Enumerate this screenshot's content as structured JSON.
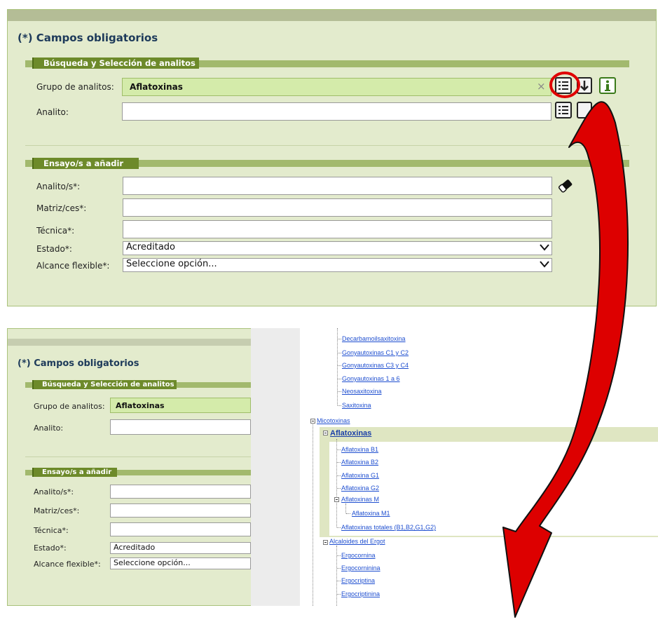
{
  "top_form": {
    "required_note": "(*) Campos obligatorios",
    "search_section": {
      "title": "Búsqueda y Selección de analitos",
      "group_label": "Grupo de analitos:",
      "group_value": "Aflatoxinas",
      "clear_symbol": "×",
      "analyte_label": "Analito:",
      "analyte_value": ""
    },
    "add_section": {
      "title": "Ensayo/s a añadir",
      "analytes_label": "Analito/s*:",
      "matrix_label": "Matriz/ces*:",
      "technique_label": "Técnica*:",
      "state_label": "Estado*:",
      "state_value": "Acreditado",
      "scope_label": "Alcance flexible*:",
      "scope_value": "Seleccione opción..."
    }
  },
  "bottom_form": {
    "required_note": "(*) Campos obligatorios",
    "search_title": "Búsqueda y Selección de analitos",
    "group_label": "Grupo de analitos:",
    "group_value": "Aflatoxinas",
    "analyte_label": "Analito:",
    "add_title": "Ensayo/s a añadir",
    "analytes_label": "Analito/s*:",
    "matrix_label": "Matriz/ces*:",
    "technique_label": "Técnica*:",
    "state_label": "Estado*:",
    "state_value": "Acreditado",
    "scope_label": "Alcance flexible*:",
    "scope_value": "Seleccione opción..."
  },
  "tree": {
    "above_items": [
      "Decarbamoilsaxitoxina",
      "Gonyautoxinas C1 y C2",
      "Gonyautoxinas C3 y C4",
      "Gonyautoxinas 1 a 6",
      "Neosaxitoxina",
      "Saxitoxina"
    ],
    "micotoxinas": "Micotoxinas",
    "aflatoxinas": "Aflatoxinas",
    "aflatoxin_items": [
      "Aflatoxina B1",
      "Aflatoxina B2",
      "Aflatoxina G1",
      "Aflatoxina G2"
    ],
    "aflatoxinas_m": "Aflatoxinas M",
    "aflatoxina_m1": "Aflatoxina M1",
    "aflatoxinas_totales": "Aflatoxinas totales (B1,B2,G1,G2)",
    "alcaloides": "Alcaloides del Ergot",
    "ergot_items": [
      "Ergocornina",
      "Ergocorninina",
      "Ergocriptina",
      "Ergocriptinina"
    ]
  },
  "icons": {
    "list": "list-icon",
    "down_arrow": "down-arrow-icon",
    "info": "info-icon",
    "eraser": "eraser-icon",
    "callout_arrow": "curved-arrow",
    "circle": "highlight-circle"
  },
  "colors": {
    "panel_bg": "#e3ebcd",
    "section_title_bg": "#6d8a2a",
    "highlight_input": "#d4ebaa",
    "link": "#1f4fd0",
    "annotation": "#d40000"
  }
}
